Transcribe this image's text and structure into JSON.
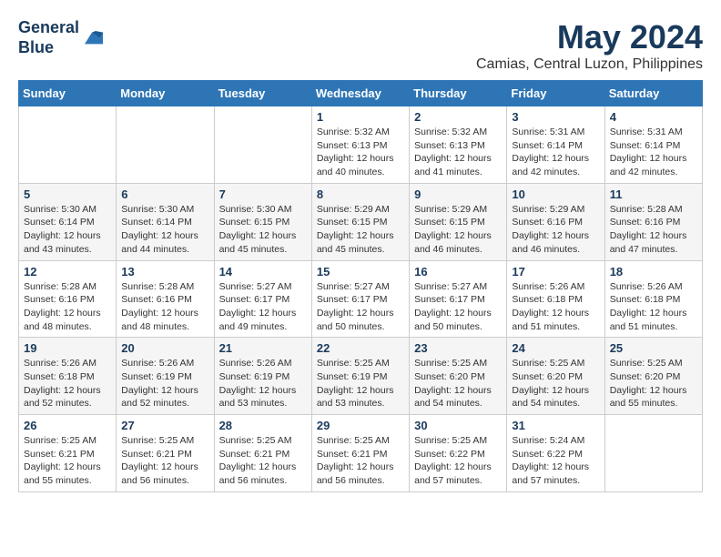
{
  "logo": {
    "line1": "General",
    "line2": "Blue"
  },
  "title": "May 2024",
  "location": "Camias, Central Luzon, Philippines",
  "weekdays": [
    "Sunday",
    "Monday",
    "Tuesday",
    "Wednesday",
    "Thursday",
    "Friday",
    "Saturday"
  ],
  "weeks": [
    [
      {
        "day": "",
        "info": ""
      },
      {
        "day": "",
        "info": ""
      },
      {
        "day": "",
        "info": ""
      },
      {
        "day": "1",
        "sunrise": "5:32 AM",
        "sunset": "6:13 PM",
        "daylight": "12 hours and 40 minutes."
      },
      {
        "day": "2",
        "sunrise": "5:32 AM",
        "sunset": "6:13 PM",
        "daylight": "12 hours and 41 minutes."
      },
      {
        "day": "3",
        "sunrise": "5:31 AM",
        "sunset": "6:14 PM",
        "daylight": "12 hours and 42 minutes."
      },
      {
        "day": "4",
        "sunrise": "5:31 AM",
        "sunset": "6:14 PM",
        "daylight": "12 hours and 42 minutes."
      }
    ],
    [
      {
        "day": "5",
        "sunrise": "5:30 AM",
        "sunset": "6:14 PM",
        "daylight": "12 hours and 43 minutes."
      },
      {
        "day": "6",
        "sunrise": "5:30 AM",
        "sunset": "6:14 PM",
        "daylight": "12 hours and 44 minutes."
      },
      {
        "day": "7",
        "sunrise": "5:30 AM",
        "sunset": "6:15 PM",
        "daylight": "12 hours and 45 minutes."
      },
      {
        "day": "8",
        "sunrise": "5:29 AM",
        "sunset": "6:15 PM",
        "daylight": "12 hours and 45 minutes."
      },
      {
        "day": "9",
        "sunrise": "5:29 AM",
        "sunset": "6:15 PM",
        "daylight": "12 hours and 46 minutes."
      },
      {
        "day": "10",
        "sunrise": "5:29 AM",
        "sunset": "6:16 PM",
        "daylight": "12 hours and 46 minutes."
      },
      {
        "day": "11",
        "sunrise": "5:28 AM",
        "sunset": "6:16 PM",
        "daylight": "12 hours and 47 minutes."
      }
    ],
    [
      {
        "day": "12",
        "sunrise": "5:28 AM",
        "sunset": "6:16 PM",
        "daylight": "12 hours and 48 minutes."
      },
      {
        "day": "13",
        "sunrise": "5:28 AM",
        "sunset": "6:16 PM",
        "daylight": "12 hours and 48 minutes."
      },
      {
        "day": "14",
        "sunrise": "5:27 AM",
        "sunset": "6:17 PM",
        "daylight": "12 hours and 49 minutes."
      },
      {
        "day": "15",
        "sunrise": "5:27 AM",
        "sunset": "6:17 PM",
        "daylight": "12 hours and 50 minutes."
      },
      {
        "day": "16",
        "sunrise": "5:27 AM",
        "sunset": "6:17 PM",
        "daylight": "12 hours and 50 minutes."
      },
      {
        "day": "17",
        "sunrise": "5:26 AM",
        "sunset": "6:18 PM",
        "daylight": "12 hours and 51 minutes."
      },
      {
        "day": "18",
        "sunrise": "5:26 AM",
        "sunset": "6:18 PM",
        "daylight": "12 hours and 51 minutes."
      }
    ],
    [
      {
        "day": "19",
        "sunrise": "5:26 AM",
        "sunset": "6:18 PM",
        "daylight": "12 hours and 52 minutes."
      },
      {
        "day": "20",
        "sunrise": "5:26 AM",
        "sunset": "6:19 PM",
        "daylight": "12 hours and 52 minutes."
      },
      {
        "day": "21",
        "sunrise": "5:26 AM",
        "sunset": "6:19 PM",
        "daylight": "12 hours and 53 minutes."
      },
      {
        "day": "22",
        "sunrise": "5:25 AM",
        "sunset": "6:19 PM",
        "daylight": "12 hours and 53 minutes."
      },
      {
        "day": "23",
        "sunrise": "5:25 AM",
        "sunset": "6:20 PM",
        "daylight": "12 hours and 54 minutes."
      },
      {
        "day": "24",
        "sunrise": "5:25 AM",
        "sunset": "6:20 PM",
        "daylight": "12 hours and 54 minutes."
      },
      {
        "day": "25",
        "sunrise": "5:25 AM",
        "sunset": "6:20 PM",
        "daylight": "12 hours and 55 minutes."
      }
    ],
    [
      {
        "day": "26",
        "sunrise": "5:25 AM",
        "sunset": "6:21 PM",
        "daylight": "12 hours and 55 minutes."
      },
      {
        "day": "27",
        "sunrise": "5:25 AM",
        "sunset": "6:21 PM",
        "daylight": "12 hours and 56 minutes."
      },
      {
        "day": "28",
        "sunrise": "5:25 AM",
        "sunset": "6:21 PM",
        "daylight": "12 hours and 56 minutes."
      },
      {
        "day": "29",
        "sunrise": "5:25 AM",
        "sunset": "6:21 PM",
        "daylight": "12 hours and 56 minutes."
      },
      {
        "day": "30",
        "sunrise": "5:25 AM",
        "sunset": "6:22 PM",
        "daylight": "12 hours and 57 minutes."
      },
      {
        "day": "31",
        "sunrise": "5:24 AM",
        "sunset": "6:22 PM",
        "daylight": "12 hours and 57 minutes."
      },
      {
        "day": "",
        "info": ""
      }
    ]
  ]
}
